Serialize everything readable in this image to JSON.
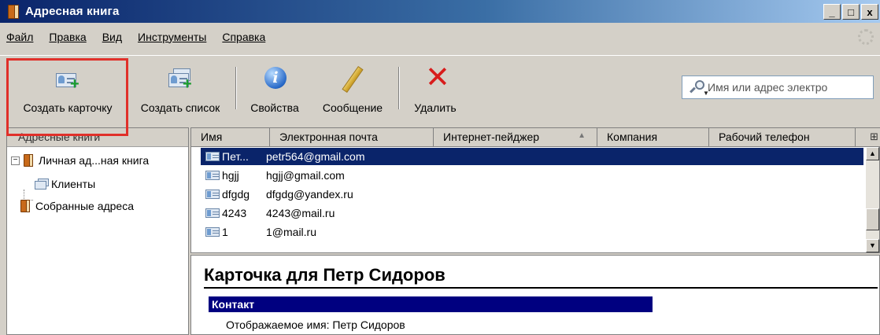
{
  "window": {
    "title": "Адресная книга",
    "buttons": [
      "_",
      "□",
      "x"
    ]
  },
  "menu": [
    {
      "label": "Файл"
    },
    {
      "label": "Правка"
    },
    {
      "label": "Вид"
    },
    {
      "label": "Инструменты"
    },
    {
      "label": "Справка"
    }
  ],
  "toolbar": {
    "new_card": "Создать карточку",
    "new_list": "Создать список",
    "properties": "Свойства",
    "message": "Сообщение",
    "delete": "Удалить"
  },
  "search": {
    "placeholder": "Имя или адрес электро"
  },
  "sidebar": {
    "header": "Адресные книги",
    "items": [
      {
        "label": "Личная ад...ная книга"
      },
      {
        "label": "Клиенты"
      },
      {
        "label": "Собранные адреса"
      }
    ]
  },
  "list": {
    "columns": [
      "Имя",
      "Электронная почта",
      "Интернет-пейджер",
      "Компания",
      "Рабочий телефон"
    ],
    "rows": [
      {
        "name": "Пет...",
        "email": "petr564@gmail.com",
        "selected": true
      },
      {
        "name": "hgjj",
        "email": "hgjj@gmail.com",
        "selected": false
      },
      {
        "name": "dfgdg",
        "email": "dfgdg@yandex.ru",
        "selected": false
      },
      {
        "name": "4243",
        "email": "4243@mail.ru",
        "selected": false
      },
      {
        "name": "1",
        "email": "1@mail.ru",
        "selected": false
      }
    ]
  },
  "detail": {
    "heading": "Карточка для Петр Сидоров",
    "section": "Контакт",
    "display_name_label": "Отображаемое имя:",
    "display_name_value": "Петр Сидоров"
  },
  "colors": {
    "selection": "#0a246a",
    "section_bar": "#000080",
    "highlight_box": "#e0302a"
  }
}
